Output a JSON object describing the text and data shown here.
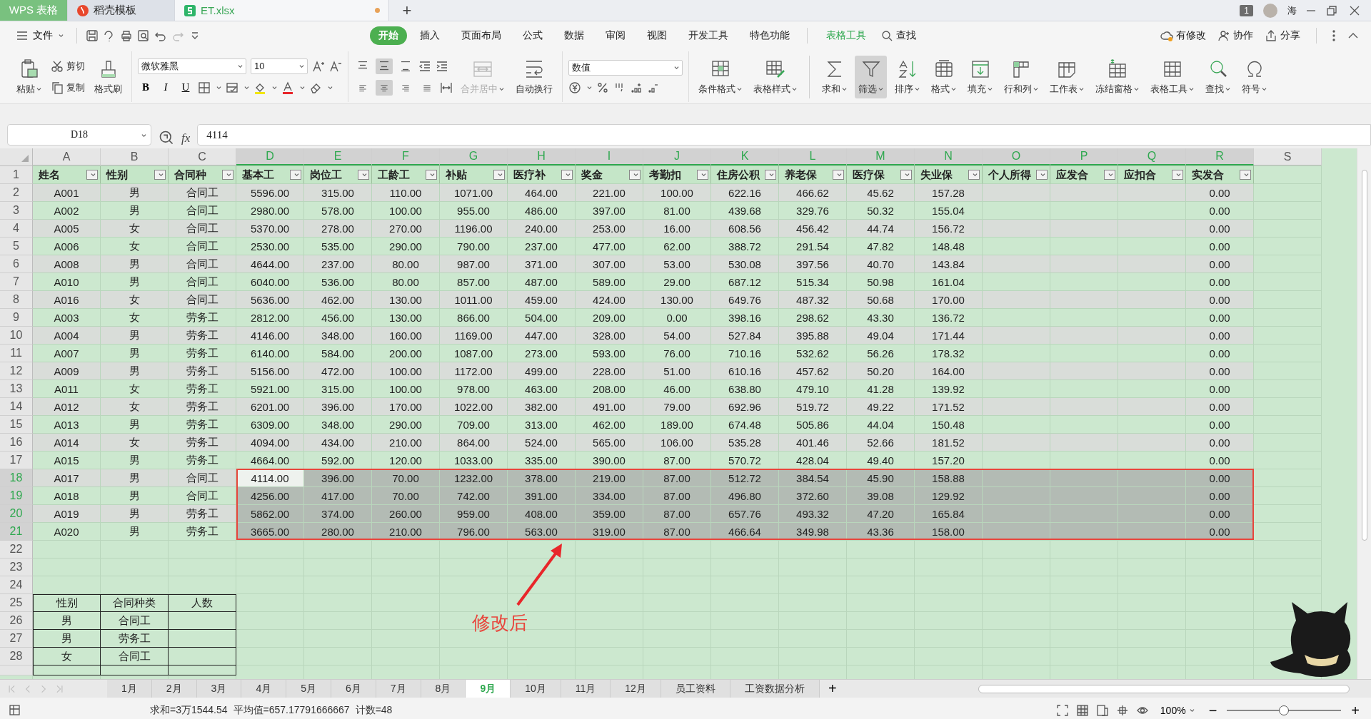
{
  "title_bar": {
    "tabs": [
      {
        "label": "WPS 表格",
        "kind": "app",
        "selected": false
      },
      {
        "label": "稻壳模板",
        "kind": "doc",
        "selected": false
      },
      {
        "label": "ET.xlsx",
        "kind": "sheet",
        "selected": true,
        "modified": true
      }
    ],
    "new_tab": "+",
    "window_count": "1",
    "user": "海"
  },
  "menu": {
    "file": "文件",
    "tabs": [
      {
        "label": "开始",
        "selected": true
      },
      {
        "label": "插入",
        "selected": false
      },
      {
        "label": "页面布局",
        "selected": false
      },
      {
        "label": "公式",
        "selected": false
      },
      {
        "label": "数据",
        "selected": false
      },
      {
        "label": "审阅",
        "selected": false
      },
      {
        "label": "视图",
        "selected": false
      },
      {
        "label": "开发工具",
        "selected": false
      },
      {
        "label": "特色功能",
        "selected": false
      }
    ],
    "context_tab": "表格工具",
    "search": "查找",
    "actions": [
      "有修改",
      "协作",
      "分享"
    ]
  },
  "ribbon": {
    "clipboard": {
      "paste": "粘贴",
      "cut": "剪切",
      "copy": "复制",
      "format_painter": "格式刷"
    },
    "font": {
      "family": "微软雅黑",
      "size": "10",
      "bold": "B",
      "italic": "I",
      "underline": "U"
    },
    "valign": [
      {
        "selected": false
      },
      {
        "selected": true
      },
      {
        "selected": false
      }
    ],
    "halign": [
      {
        "selected": false
      },
      {
        "selected": true
      },
      {
        "selected": false
      },
      {
        "selected": false
      }
    ],
    "merge": {
      "label": "合并居中",
      "disabled": true
    },
    "wrap": {
      "label": "自动换行",
      "disabled": false
    },
    "number_format": "数值",
    "tools": [
      {
        "label": "条件格式",
        "selected": false
      },
      {
        "label": "表格样式",
        "selected": false
      },
      {
        "label": "求和",
        "selected": false
      },
      {
        "label": "筛选",
        "selected": true
      },
      {
        "label": "排序",
        "selected": false
      },
      {
        "label": "格式",
        "selected": false
      },
      {
        "label": "填充",
        "selected": false
      },
      {
        "label": "行和列",
        "selected": false
      },
      {
        "label": "工作表",
        "selected": false
      },
      {
        "label": "冻结窗格",
        "selected": false
      },
      {
        "label": "表格工具",
        "selected": false
      },
      {
        "label": "查找",
        "selected": false
      },
      {
        "label": "符号",
        "selected": false
      }
    ]
  },
  "formula_bar": {
    "name_box": "D18",
    "fx": "fx",
    "value": "4114"
  },
  "columns": [
    {
      "letter": "A",
      "selected": false
    },
    {
      "letter": "B",
      "selected": false
    },
    {
      "letter": "C",
      "selected": false
    },
    {
      "letter": "D",
      "selected": true,
      "active": true
    },
    {
      "letter": "E",
      "selected": true
    },
    {
      "letter": "F",
      "selected": true
    },
    {
      "letter": "G",
      "selected": true
    },
    {
      "letter": "H",
      "selected": true
    },
    {
      "letter": "I",
      "selected": true
    },
    {
      "letter": "J",
      "selected": true
    },
    {
      "letter": "K",
      "selected": true
    },
    {
      "letter": "L",
      "selected": true
    },
    {
      "letter": "M",
      "selected": true
    },
    {
      "letter": "N",
      "selected": true
    },
    {
      "letter": "O",
      "selected": true
    },
    {
      "letter": "P",
      "selected": true
    },
    {
      "letter": "Q",
      "selected": true
    },
    {
      "letter": "R",
      "selected": true
    },
    {
      "letter": "S",
      "selected": false
    }
  ],
  "header_row": {
    "n": "1",
    "labels": [
      "姓名",
      "性别",
      "合同种",
      "基本工",
      "岗位工",
      "工龄工",
      "补贴",
      "医疗补",
      "奖金",
      "考勤扣",
      "住房公积",
      "养老保",
      "医疗保",
      "失业保",
      "个人所得",
      "应发合",
      "应扣合",
      "实发合"
    ]
  },
  "rows": [
    {
      "n": "2",
      "cells": [
        "A001",
        "男",
        "合同工",
        "5596.00",
        "315.00",
        "110.00",
        "1071.00",
        "464.00",
        "221.00",
        "100.00",
        "622.16",
        "466.62",
        "45.62",
        "157.28"
      ],
      "total": "0.00",
      "selected": false
    },
    {
      "n": "3",
      "cells": [
        "A002",
        "男",
        "合同工",
        "2980.00",
        "578.00",
        "100.00",
        "955.00",
        "486.00",
        "397.00",
        "81.00",
        "439.68",
        "329.76",
        "50.32",
        "155.04"
      ],
      "total": "0.00",
      "selected": false
    },
    {
      "n": "4",
      "cells": [
        "A005",
        "女",
        "合同工",
        "5370.00",
        "278.00",
        "270.00",
        "1196.00",
        "240.00",
        "253.00",
        "16.00",
        "608.56",
        "456.42",
        "44.74",
        "156.72"
      ],
      "total": "0.00",
      "selected": false
    },
    {
      "n": "5",
      "cells": [
        "A006",
        "女",
        "合同工",
        "2530.00",
        "535.00",
        "290.00",
        "790.00",
        "237.00",
        "477.00",
        "62.00",
        "388.72",
        "291.54",
        "47.82",
        "148.48"
      ],
      "total": "0.00",
      "selected": false
    },
    {
      "n": "6",
      "cells": [
        "A008",
        "男",
        "合同工",
        "4644.00",
        "237.00",
        "80.00",
        "987.00",
        "371.00",
        "307.00",
        "53.00",
        "530.08",
        "397.56",
        "40.70",
        "143.84"
      ],
      "total": "0.00",
      "selected": false
    },
    {
      "n": "7",
      "cells": [
        "A010",
        "男",
        "合同工",
        "6040.00",
        "536.00",
        "80.00",
        "857.00",
        "487.00",
        "589.00",
        "29.00",
        "687.12",
        "515.34",
        "50.98",
        "161.04"
      ],
      "total": "0.00",
      "selected": false
    },
    {
      "n": "8",
      "cells": [
        "A016",
        "女",
        "合同工",
        "5636.00",
        "462.00",
        "130.00",
        "1011.00",
        "459.00",
        "424.00",
        "130.00",
        "649.76",
        "487.32",
        "50.68",
        "170.00"
      ],
      "total": "0.00",
      "selected": false
    },
    {
      "n": "9",
      "cells": [
        "A003",
        "女",
        "劳务工",
        "2812.00",
        "456.00",
        "130.00",
        "866.00",
        "504.00",
        "209.00",
        "0.00",
        "398.16",
        "298.62",
        "43.30",
        "136.72"
      ],
      "total": "0.00",
      "selected": false
    },
    {
      "n": "10",
      "cells": [
        "A004",
        "男",
        "劳务工",
        "4146.00",
        "348.00",
        "160.00",
        "1169.00",
        "447.00",
        "328.00",
        "54.00",
        "527.84",
        "395.88",
        "49.04",
        "171.44"
      ],
      "total": "0.00",
      "selected": false
    },
    {
      "n": "11",
      "cells": [
        "A007",
        "男",
        "劳务工",
        "6140.00",
        "584.00",
        "200.00",
        "1087.00",
        "273.00",
        "593.00",
        "76.00",
        "710.16",
        "532.62",
        "56.26",
        "178.32"
      ],
      "total": "0.00",
      "selected": false
    },
    {
      "n": "12",
      "cells": [
        "A009",
        "男",
        "劳务工",
        "5156.00",
        "472.00",
        "100.00",
        "1172.00",
        "499.00",
        "228.00",
        "51.00",
        "610.16",
        "457.62",
        "50.20",
        "164.00"
      ],
      "total": "0.00",
      "selected": false
    },
    {
      "n": "13",
      "cells": [
        "A011",
        "女",
        "劳务工",
        "5921.00",
        "315.00",
        "100.00",
        "978.00",
        "463.00",
        "208.00",
        "46.00",
        "638.80",
        "479.10",
        "41.28",
        "139.92"
      ],
      "total": "0.00",
      "selected": false
    },
    {
      "n": "14",
      "cells": [
        "A012",
        "女",
        "劳务工",
        "6201.00",
        "396.00",
        "170.00",
        "1022.00",
        "382.00",
        "491.00",
        "79.00",
        "692.96",
        "519.72",
        "49.22",
        "171.52"
      ],
      "total": "0.00",
      "selected": false
    },
    {
      "n": "15",
      "cells": [
        "A013",
        "男",
        "劳务工",
        "6309.00",
        "348.00",
        "290.00",
        "709.00",
        "313.00",
        "462.00",
        "189.00",
        "674.48",
        "505.86",
        "44.04",
        "150.48"
      ],
      "total": "0.00",
      "selected": false
    },
    {
      "n": "16",
      "cells": [
        "A014",
        "女",
        "劳务工",
        "4094.00",
        "434.00",
        "210.00",
        "864.00",
        "524.00",
        "565.00",
        "106.00",
        "535.28",
        "401.46",
        "52.66",
        "181.52"
      ],
      "total": "0.00",
      "selected": false
    },
    {
      "n": "17",
      "cells": [
        "A015",
        "男",
        "劳务工",
        "4664.00",
        "592.00",
        "120.00",
        "1033.00",
        "335.00",
        "390.00",
        "87.00",
        "570.72",
        "428.04",
        "49.40",
        "157.20"
      ],
      "total": "0.00",
      "selected": false
    },
    {
      "n": "18",
      "cells": [
        "A017",
        "男",
        "合同工",
        "4114.00",
        "396.00",
        "70.00",
        "1232.00",
        "378.00",
        "219.00",
        "87.00",
        "512.72",
        "384.54",
        "45.90",
        "158.88"
      ],
      "total": "0.00",
      "selected": true,
      "active": true
    },
    {
      "n": "19",
      "cells": [
        "A018",
        "男",
        "合同工",
        "4256.00",
        "417.00",
        "70.00",
        "742.00",
        "391.00",
        "334.00",
        "87.00",
        "496.80",
        "372.60",
        "39.08",
        "129.92"
      ],
      "total": "0.00",
      "selected": true
    },
    {
      "n": "20",
      "cells": [
        "A019",
        "男",
        "劳务工",
        "5862.00",
        "374.00",
        "260.00",
        "959.00",
        "408.00",
        "359.00",
        "87.00",
        "657.76",
        "493.32",
        "47.20",
        "165.84"
      ],
      "total": "0.00",
      "selected": true
    },
    {
      "n": "21",
      "cells": [
        "A020",
        "男",
        "劳务工",
        "3665.00",
        "280.00",
        "210.00",
        "796.00",
        "563.00",
        "319.00",
        "87.00",
        "466.64",
        "349.98",
        "43.36",
        "158.00"
      ],
      "total": "0.00",
      "selected": true
    }
  ],
  "empty_rows": [
    "22",
    "23",
    "24"
  ],
  "summary_table": {
    "n": "25",
    "labels": [
      "性别",
      "合同种类",
      "人数"
    ],
    "rows": [
      {
        "n": "26",
        "cells": [
          "男",
          "合同工"
        ]
      },
      {
        "n": "27",
        "cells": [
          "男",
          "劳务工"
        ]
      },
      {
        "n": "28",
        "cells": [
          "女",
          "合同工"
        ]
      }
    ]
  },
  "annotation": {
    "text": "修改后"
  },
  "sheet_tabs": [
    {
      "label": "1月",
      "selected": false
    },
    {
      "label": "2月",
      "selected": false
    },
    {
      "label": "3月",
      "selected": false
    },
    {
      "label": "4月",
      "selected": false
    },
    {
      "label": "5月",
      "selected": false
    },
    {
      "label": "6月",
      "selected": false
    },
    {
      "label": "7月",
      "selected": false
    },
    {
      "label": "8月",
      "selected": false
    },
    {
      "label": "9月",
      "selected": true
    },
    {
      "label": "10月",
      "selected": false
    },
    {
      "label": "11月",
      "selected": false
    },
    {
      "label": "12月",
      "selected": false
    },
    {
      "label": "员工资料",
      "selected": false
    },
    {
      "label": "工资数据分析",
      "selected": false
    }
  ],
  "add_sheet": "+",
  "status_bar": {
    "stats": [
      "求和=3万1544.54",
      "平均值=657.17791666667",
      "计数=48"
    ],
    "zoom": "100%",
    "zoom_out": "−",
    "zoom_in": "+",
    "level": 0.5
  }
}
